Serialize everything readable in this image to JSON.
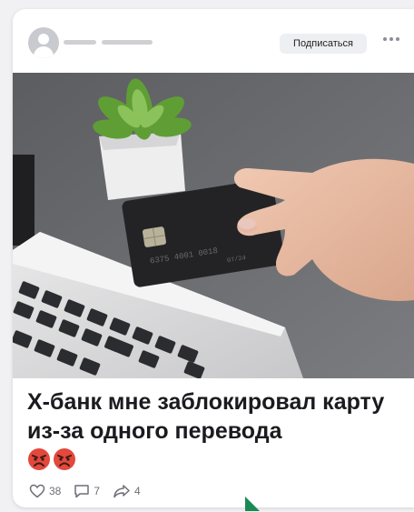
{
  "post": {
    "subscribe_label": "Подписаться",
    "title": "Х-банк мне заблокировал карту из-за одного перевода",
    "card_number_text": "6375 4001 0018",
    "card_extra_text": "07/24"
  },
  "stats": {
    "likes": "38",
    "comments": "7",
    "shares": "4"
  },
  "icons": {
    "more": "ellipsis-icon",
    "like": "heart-icon",
    "comment": "comment-icon",
    "share": "share-icon",
    "emoji": "angry-face-emoji"
  },
  "colors": {
    "accent_corner": "#1a8a55"
  }
}
